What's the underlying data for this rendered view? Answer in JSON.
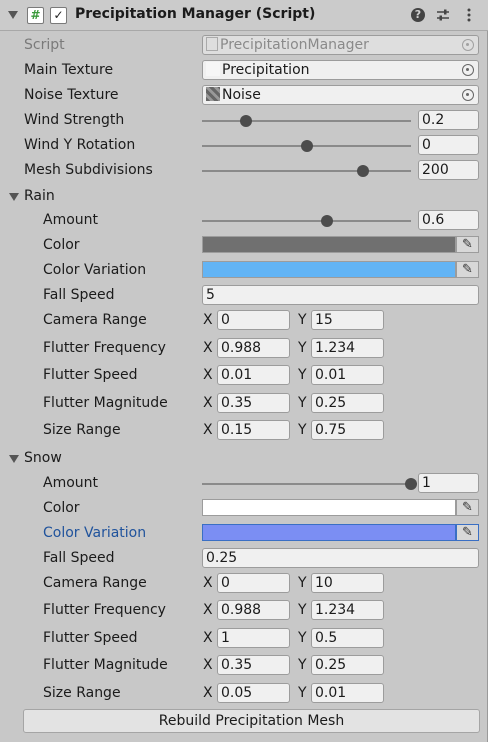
{
  "header": {
    "title": "Precipitation Manager (Script)"
  },
  "script": {
    "label": "Script",
    "value": "PrecipitationManager"
  },
  "main_texture": {
    "label": "Main Texture",
    "value": "Precipitation"
  },
  "noise_texture": {
    "label": "Noise Texture",
    "value": "Noise"
  },
  "wind_strength": {
    "label": "Wind Strength",
    "value": "0.2",
    "fraction": 0.21
  },
  "wind_y_rotation": {
    "label": "Wind Y Rotation",
    "value": "0",
    "fraction": 0.5
  },
  "mesh_subdivisions": {
    "label": "Mesh Subdivisions",
    "value": "200",
    "fraction": 0.77
  },
  "rain": {
    "label": "Rain",
    "amount": {
      "label": "Amount",
      "value": "0.6",
      "fraction": 0.6
    },
    "color": {
      "label": "Color",
      "swatch": "#707070"
    },
    "color_variation": {
      "label": "Color Variation",
      "swatch": "#62b4f5"
    },
    "fall_speed": {
      "label": "Fall Speed",
      "value": "5"
    },
    "camera_range": {
      "label": "Camera Range",
      "x": "0",
      "y": "15"
    },
    "flutter_frequency": {
      "label": "Flutter Frequency",
      "x": "0.988",
      "y": "1.234"
    },
    "flutter_speed": {
      "label": "Flutter Speed",
      "x": "0.01",
      "y": "0.01"
    },
    "flutter_magnitude": {
      "label": "Flutter Magnitude",
      "x": "0.35",
      "y": "0.25"
    },
    "size_range": {
      "label": "Size Range",
      "x": "0.15",
      "y": "0.75"
    }
  },
  "snow": {
    "label": "Snow",
    "amount": {
      "label": "Amount",
      "value": "1",
      "fraction": 1.0
    },
    "color": {
      "label": "Color",
      "swatch": "#ffffff"
    },
    "color_variation": {
      "label": "Color Variation",
      "swatch": "#7b8ef3"
    },
    "fall_speed": {
      "label": "Fall Speed",
      "value": "0.25"
    },
    "camera_range": {
      "label": "Camera Range",
      "x": "0",
      "y": "10"
    },
    "flutter_frequency": {
      "label": "Flutter Frequency",
      "x": "0.988",
      "y": "1.234"
    },
    "flutter_speed": {
      "label": "Flutter Speed",
      "x": "1",
      "y": "0.5"
    },
    "flutter_magnitude": {
      "label": "Flutter Magnitude",
      "x": "0.35",
      "y": "0.25"
    },
    "size_range": {
      "label": "Size Range",
      "x": "0.05",
      "y": "0.01"
    }
  },
  "xy_labels": {
    "x": "X",
    "y": "Y"
  },
  "rebuild_button": {
    "label": "Rebuild Precipitation Mesh"
  },
  "icons": {
    "fold": "fold-arrow-icon",
    "script": "script-icon",
    "enabled": "checkmark-icon",
    "help": "help-icon",
    "presets": "presets-icon",
    "menu": "kebab-menu-icon",
    "object_picker": "object-picker-icon",
    "eyedropper": "eyedropper-icon"
  }
}
